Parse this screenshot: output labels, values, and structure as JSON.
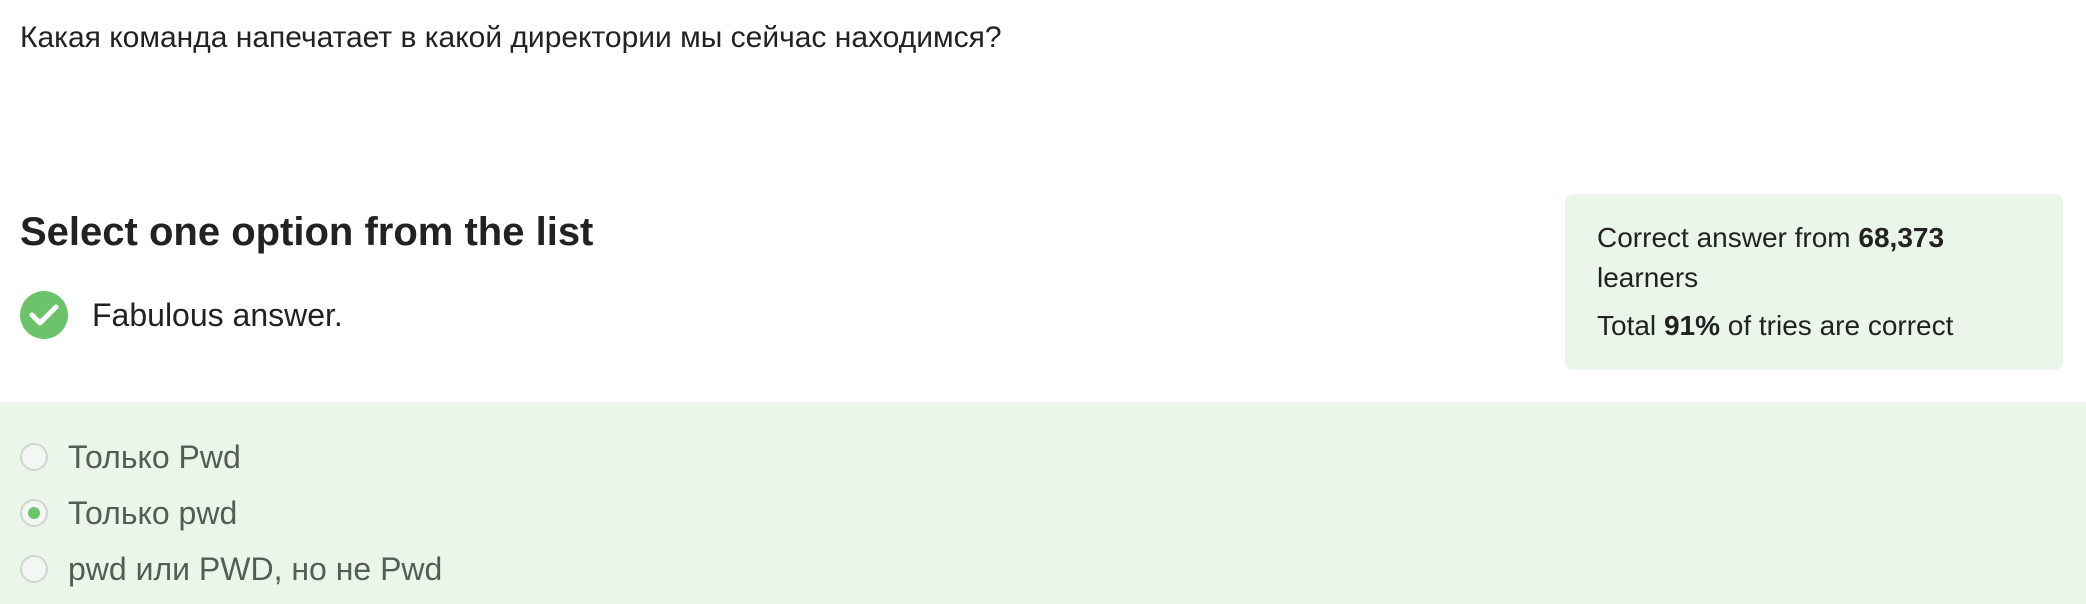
{
  "question": {
    "text": "Какая команда напечатает в какой директории мы сейчас находимся?"
  },
  "section": {
    "title": "Select one option from the list"
  },
  "feedback": {
    "icon": "checkmark-icon",
    "text": "Fabulous answer.",
    "color": "#6cc36a"
  },
  "stats": {
    "line1_prefix": "Correct answer from ",
    "learners_count": "68,373",
    "line1_suffix": " learners",
    "line2_prefix": "Total ",
    "percent": "91%",
    "line2_suffix": " of tries are correct",
    "background": "#eaf6ea"
  },
  "options": [
    {
      "label": "Только Pwd",
      "selected": false
    },
    {
      "label": "Только pwd",
      "selected": true
    },
    {
      "label": "pwd или PWD, но не Pwd",
      "selected": false
    }
  ],
  "colors": {
    "accent": "#6cc36a",
    "options_background": "#ebf6eb"
  }
}
